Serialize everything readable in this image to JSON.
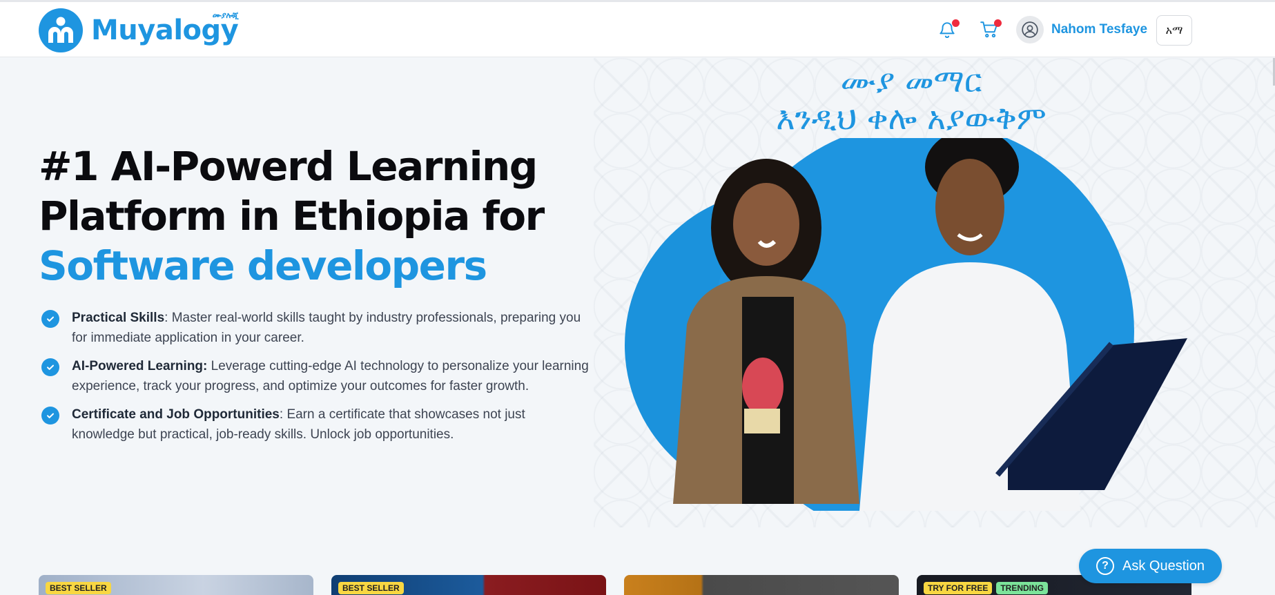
{
  "header": {
    "brand_name": "Muyalogy",
    "brand_superscript": "ሙያሎጂ",
    "notifications_icon": "bell-icon",
    "cart_icon": "cart-icon",
    "user_name": "Nahom Tesfaye",
    "language_button": "አማ"
  },
  "hero": {
    "title_line1": "#1 AI-Powerd Learning",
    "title_line2": "Platform in Ethiopia for",
    "title_accent": "Software developers",
    "amharic_line1": "ሙያ መማር",
    "amharic_line2": "እንዲህ ቀሎ አያውቅም",
    "features": [
      {
        "title": "Practical Skills",
        "sep": ": ",
        "text": "Master real-world skills taught by industry professionals, preparing you for immediate application in your career."
      },
      {
        "title": "AI-Powered Learning:",
        "sep": " ",
        "text": "Leverage cutting-edge AI technology to personalize your learning experience, track your progress, and optimize your outcomes for faster growth."
      },
      {
        "title": "Certificate and Job Opportunities",
        "sep": ": ",
        "text": "Earn a certificate that showcases not just knowledge but practical, job-ready skills. Unlock job opportunities."
      }
    ]
  },
  "cards": [
    {
      "badges": [
        "BEST SELLER"
      ]
    },
    {
      "badges": [
        "BEST SELLER"
      ]
    },
    {
      "badges": []
    },
    {
      "badges": [
        "TRY FOR FREE",
        "TRENDING"
      ]
    }
  ],
  "ask_button": {
    "label": "Ask Question"
  },
  "colors": {
    "accent": "#1e95e0",
    "badge_yellow": "#f8d742",
    "badge_green": "#7be39a",
    "notification_dot": "#ef2b3e"
  }
}
